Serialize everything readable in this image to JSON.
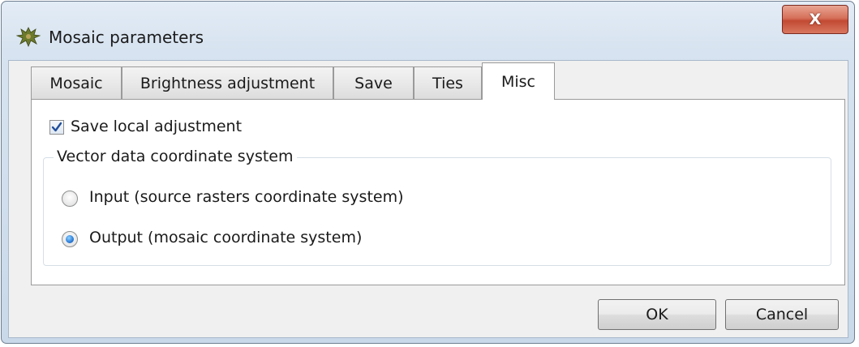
{
  "window": {
    "title": "Mosaic parameters",
    "close_label": "X"
  },
  "tabs": [
    {
      "label": "Mosaic",
      "active": false
    },
    {
      "label": "Brightness adjustment",
      "active": false
    },
    {
      "label": "Save",
      "active": false
    },
    {
      "label": "Ties",
      "active": false
    },
    {
      "label": "Misc",
      "active": true
    }
  ],
  "misc": {
    "save_local_adjustment": {
      "label": "Save local adjustment",
      "checked": true
    },
    "coordinate_system": {
      "title": "Vector data coordinate system",
      "options": [
        {
          "label": "Input (source rasters coordinate system)",
          "selected": false
        },
        {
          "label": "Output (mosaic coordinate system)",
          "selected": true
        }
      ]
    }
  },
  "buttons": {
    "ok": "OK",
    "cancel": "Cancel"
  },
  "icons": {
    "app": "mosaic-app-icon",
    "close": "close-icon",
    "check": "checkmark-icon"
  },
  "colors": {
    "title_gradient": "#d7e3f0",
    "close_button": "#c24a33",
    "radio_selected": "#2b7bd8"
  }
}
